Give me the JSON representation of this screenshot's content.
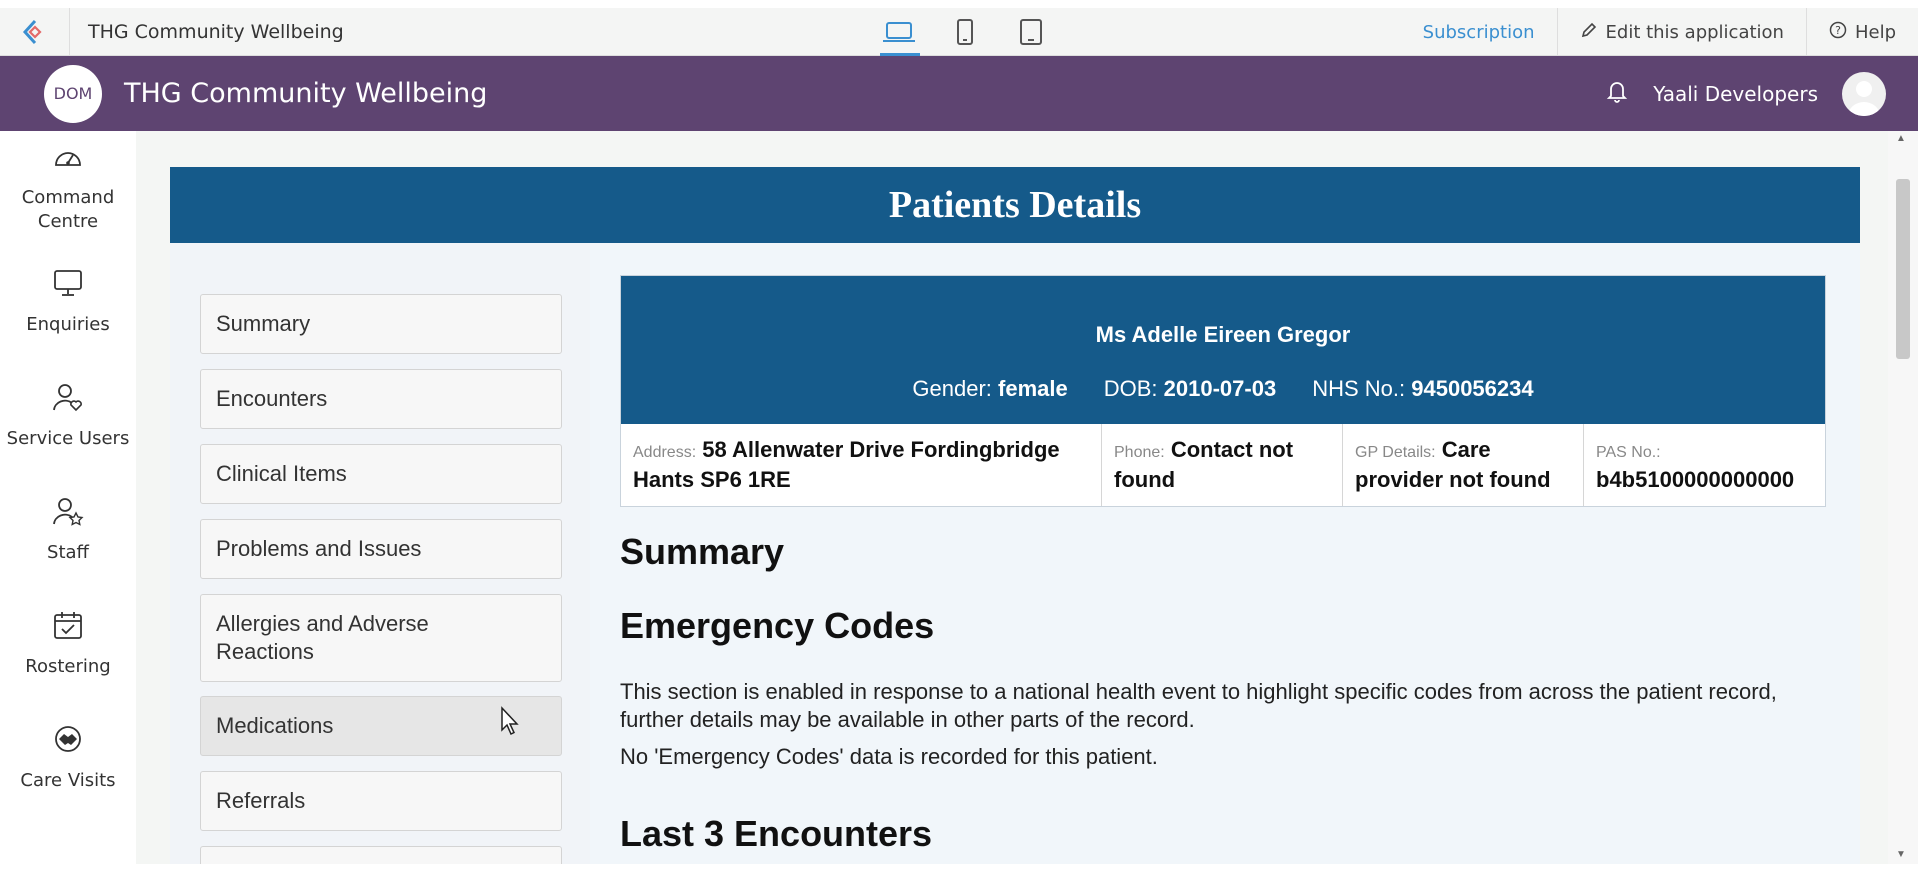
{
  "builder_bar": {
    "app_name": "THG Community Wellbeing",
    "devices": [
      "desktop-icon",
      "mobile-icon",
      "tablet-icon"
    ],
    "subscription": "Subscription",
    "edit_app": "Edit this application",
    "help": "Help"
  },
  "header": {
    "avatar_initials": "DOM",
    "title": "THG Community Wellbeing",
    "user_name": "Yaali Developers",
    "brand_color": "#5e4471"
  },
  "left_nav": [
    {
      "label": "Command Centre",
      "icon": "dashboard-icon"
    },
    {
      "label": "Enquiries",
      "icon": "monitor-icon"
    },
    {
      "label": "Service Users",
      "icon": "user-heart-icon"
    },
    {
      "label": "Staff",
      "icon": "user-star-icon"
    },
    {
      "label": "Rostering",
      "icon": "calendar-check-icon"
    },
    {
      "label": "Care Visits",
      "icon": "handshake-icon"
    }
  ],
  "page": {
    "banner_title": "Patients Details",
    "banner_color": "#155a8a",
    "side_menu": [
      "Summary",
      "Encounters",
      "Clinical Items",
      "Problems and Issues",
      "Allergies and Adverse Reactions",
      "Medications",
      "Referrals"
    ],
    "patient": {
      "name": "Ms Adelle Eireen Gregor",
      "gender_label": "Gender:",
      "gender": "female",
      "dob_label": "DOB:",
      "dob": "2010-07-03",
      "nhs_label": "NHS No.:",
      "nhs": "9450056234",
      "address_label": "Address:",
      "address": "58 Allenwater Drive Fordingbridge Hants SP6 1RE",
      "phone_label": "Phone:",
      "phone": "Contact not found",
      "gp_label": "GP Details:",
      "gp": "Care provider not found",
      "pas_label": "PAS No.:",
      "pas": "b4b5100000000000"
    },
    "summary_heading": "Summary",
    "emergency_heading": "Emergency Codes",
    "emergency_text": "This section is enabled in response to a national health event to highlight specific codes from across the patient record, further details may be available in other parts of the record.",
    "emergency_none": "No 'Emergency Codes' data is recorded for this patient.",
    "encounters_heading": "Last 3 Encounters"
  }
}
